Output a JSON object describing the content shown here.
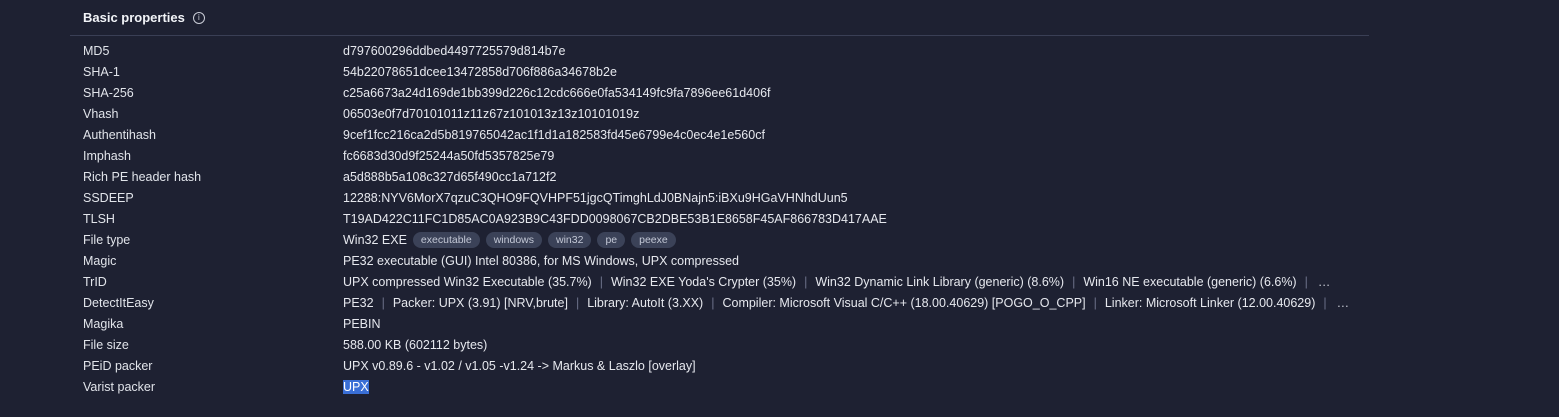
{
  "section": {
    "title": "Basic properties",
    "info_icon": "info-circle-icon"
  },
  "rows": [
    {
      "label": "MD5",
      "value": "d797600296ddbed4497725579d814b7e"
    },
    {
      "label": "SHA-1",
      "value": "54b22078651dcee13472858d706f886a34678b2e"
    },
    {
      "label": "SHA-256",
      "value": "c25a6673a24d169de1bb399d226c12cdc666e0fa534149fc9fa7896ee61d406f"
    },
    {
      "label": "Vhash",
      "value": "06503e0f7d70101011z11z67z101013z13z10101019z"
    },
    {
      "label": "Authentihash",
      "value": "9cef1fcc216ca2d5b819765042ac1f1d1a182583fd45e6799e4c0ec4e1e560cf"
    },
    {
      "label": "Imphash",
      "value": "fc6683d30d9f25244a50fd5357825e79"
    },
    {
      "label": "Rich PE header hash",
      "value": "a5d888b5a108c327d65f490cc1a712f2"
    },
    {
      "label": "SSDEEP",
      "value": "12288:NYV6MorX7qzuC3QHO9FQVHPF51jgcQTimghLdJ0BNajn5:iBXu9HGaVHNhdUun5"
    },
    {
      "label": "TLSH",
      "value": "T19AD422C11FC1D85AC0A923B9C43FDD0098067CB2DBE53B1E8658F45AF866783D417AAE"
    },
    {
      "label": "File type",
      "value": "Win32 EXE",
      "tags": [
        "executable",
        "windows",
        "win32",
        "pe",
        "peexe"
      ]
    },
    {
      "label": "Magic",
      "value": "PE32 executable (GUI) Intel 80386, for MS Windows, UPX compressed"
    },
    {
      "label": "TrID",
      "items": [
        "UPX compressed Win32 Executable (35.7%)",
        "Win32 EXE Yoda's Crypter (35%)",
        "Win32 Dynamic Link Library (generic) (8.6%)",
        "Win16 NE executable (generic) (6.6%)"
      ],
      "more": "…"
    },
    {
      "label": "DetectItEasy",
      "items": [
        "PE32",
        "Packer: UPX (3.91) [NRV,brute]",
        "Library: AutoIt (3.XX)",
        "Compiler: Microsoft Visual C/C++ (18.00.40629) [POGO_O_CPP]",
        "Linker: Microsoft Linker (12.00.40629)"
      ],
      "more": "…"
    },
    {
      "label": "Magika",
      "value": "PEBIN"
    },
    {
      "label": "File size",
      "value": "588.00 KB (602112 bytes)"
    },
    {
      "label": "PEiD packer",
      "value": "UPX v0.89.6 - v1.02 / v1.05 -v1.24 -> Markus & Laszlo [overlay]"
    },
    {
      "label": "Varist packer",
      "value": "UPX",
      "highlighted": true
    }
  ]
}
